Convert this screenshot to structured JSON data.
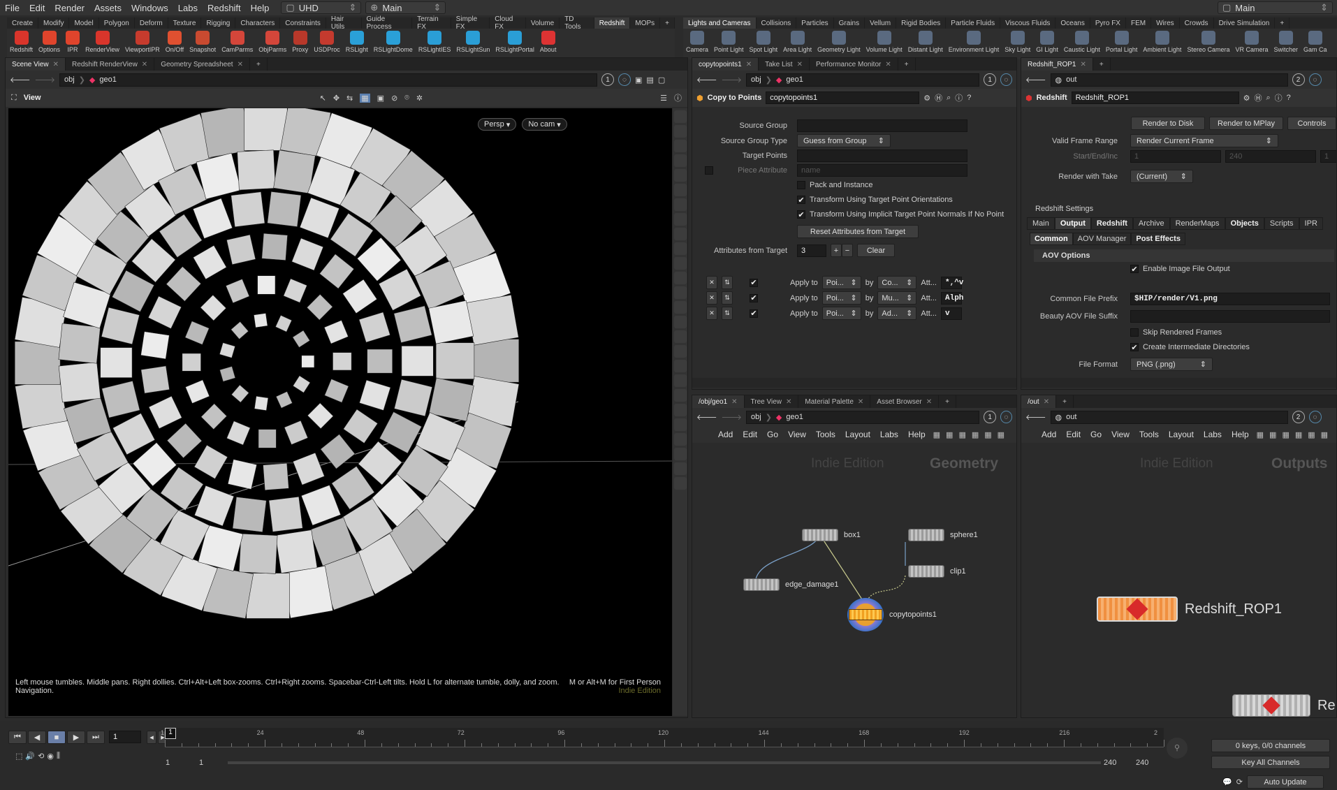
{
  "menubar": {
    "items": [
      "File",
      "Edit",
      "Render",
      "Assets",
      "Windows",
      "Labs",
      "Redshift",
      "Help"
    ],
    "desktop": "UHD",
    "context": "Main",
    "right_desktop": "Main"
  },
  "shelf_left": {
    "tabs": [
      "Create",
      "Modify",
      "Model",
      "Polygon",
      "Deform",
      "Texture",
      "Rigging",
      "Characters",
      "Constraints",
      "Hair Utils",
      "Guide Process",
      "Terrain FX",
      "Simple FX",
      "Cloud FX",
      "Volume",
      "TD Tools",
      "Redshift",
      "MOPs"
    ],
    "active_tab": "Redshift",
    "tools": [
      "Redshift",
      "Options",
      "IPR",
      "RenderView",
      "ViewportIPR",
      "On/Off",
      "Snapshot",
      "CamParms",
      "ObjParms",
      "Proxy",
      "USDProc",
      "RSLight",
      "RSLightDome",
      "RSLightIES",
      "RSLightSun",
      "RSLightPortal",
      "About"
    ],
    "tool_colors": [
      "#d9352b",
      "#e0442c",
      "#e0442c",
      "#d9352b",
      "#c73b2d",
      "#e05030",
      "#c94a30",
      "#d4463a",
      "#d4463a",
      "#b8382a",
      "#c43a2e",
      "#2aa0d8",
      "#2aa0d8",
      "#2a9ed6",
      "#2a9ed6",
      "#2a9ed6",
      "#d33"
    ]
  },
  "shelf_right": {
    "tabs": [
      "Lights and Cameras",
      "Collisions",
      "Particles",
      "Grains",
      "Vellum",
      "Rigid Bodies",
      "Particle Fluids",
      "Viscous Fluids",
      "Oceans",
      "Pyro FX",
      "FEM",
      "Wires",
      "Crowds",
      "Drive Simulation"
    ],
    "active_tab": "Lights and Cameras",
    "tools": [
      "Camera",
      "Point Light",
      "Spot Light",
      "Area Light",
      "Geometry Light",
      "Volume Light",
      "Distant Light",
      "Environment Light",
      "Sky Light",
      "GI Light",
      "Caustic Light",
      "Portal Light",
      "Ambient Light",
      "Stereo Camera",
      "VR Camera",
      "Switcher",
      "Gam Ca"
    ]
  },
  "scene_panel": {
    "tabs": [
      "Scene View",
      "Redshift RenderView",
      "Geometry Spreadsheet"
    ],
    "path_root": "obj",
    "path_node": "geo1",
    "counter": "1",
    "view_label": "View",
    "persp": "Persp",
    "cam": "No cam",
    "help_text": "Left mouse tumbles. Middle pans. Right dollies. Ctrl+Alt+Left box-zooms. Ctrl+Right zooms. Spacebar-Ctrl-Left tilts. Hold L for alternate tumble, dolly, and zoom.",
    "help_text2": "Navigation.",
    "help_right": "M or Alt+M for First Person",
    "edition": "Indie Edition"
  },
  "param_panel": {
    "tabs": [
      "copytopoints1",
      "Take List",
      "Performance Monitor"
    ],
    "path_root": "obj",
    "path_node": "geo1",
    "counter": "1",
    "node_type": "Copy to Points",
    "node_name": "copytopoints1",
    "source_group_label": "Source Group",
    "source_group_type_label": "Source Group Type",
    "source_group_type": "Guess from Group",
    "target_points_label": "Target Points",
    "piece_attribute_label": "Piece Attribute",
    "piece_attribute_placeholder": "name",
    "pack_label": "Pack and Instance",
    "orient_label": "Transform Using Target Point Orientations",
    "normals_label": "Transform Using Implicit Target Point Normals If No Point",
    "reset_btn": "Reset Attributes from Target",
    "attrs_label": "Attributes from Target",
    "attrs_count": "3",
    "clear_btn": "Clear",
    "attr_rows": [
      {
        "apply": "Apply to",
        "target": "Poi...",
        "by": "by",
        "method": "Co...",
        "att": "Att...",
        "value": "*,^v"
      },
      {
        "apply": "Apply to",
        "target": "Poi...",
        "by": "by",
        "method": "Mu...",
        "att": "Att...",
        "value": "Alph"
      },
      {
        "apply": "Apply to",
        "target": "Poi...",
        "by": "by",
        "method": "Ad...",
        "att": "Att...",
        "value": "v"
      }
    ]
  },
  "rop_panel": {
    "tabs": [
      "Redshift_ROP1"
    ],
    "path": "out",
    "counter": "2",
    "node_type": "Redshift",
    "node_name": "Redshift_ROP1",
    "render_disk": "Render to Disk",
    "render_mplay": "Render to MPlay",
    "controls": "Controls",
    "valid_range_label": "Valid Frame Range",
    "valid_range": "Render Current Frame",
    "startend_label": "Start/End/Inc",
    "start": "1",
    "end": "240",
    "inc": "1",
    "take_label": "Render with Take",
    "take": "(Current)",
    "settings_label": "Redshift Settings",
    "tabs2": [
      "Main",
      "Output",
      "Redshift",
      "Archive",
      "RenderMaps",
      "Objects",
      "Scripts",
      "IPR"
    ],
    "active_tab2": "Output",
    "subtabs": [
      "Common",
      "AOV Manager",
      "Post Effects"
    ],
    "aov_header": "AOV Options",
    "enable_output": "Enable Image File Output",
    "prefix_label": "Common File Prefix",
    "prefix": "$HIP/render/V1.png",
    "suffix_label": "Beauty AOV File Suffix",
    "skip_label": "Skip Rendered Frames",
    "create_dirs": "Create Intermediate Directories",
    "format_label": "File Format",
    "format": "PNG (.png)"
  },
  "network_geo": {
    "tabs": [
      "/obj/geo1",
      "Tree View",
      "Material Palette",
      "Asset Browser"
    ],
    "path_root": "obj",
    "path_node": "geo1",
    "counter": "1",
    "menu": [
      "Add",
      "Edit",
      "Go",
      "View",
      "Tools",
      "Layout",
      "Labs",
      "Help"
    ],
    "watermark": "Indie Edition",
    "context": "Geometry",
    "nodes": [
      {
        "name": "box1"
      },
      {
        "name": "sphere1"
      },
      {
        "name": "clip1"
      },
      {
        "name": "edge_damage1"
      },
      {
        "name": "copytopoints1"
      }
    ]
  },
  "network_out": {
    "tabs": [
      "/out"
    ],
    "path": "out",
    "counter": "2",
    "menu": [
      "Add",
      "Edit",
      "Go",
      "View",
      "Tools",
      "Layout",
      "Labs",
      "Help"
    ],
    "watermark": "Indie Edition",
    "context": "Outputs",
    "node_name": "Redshift_ROP1",
    "node2": "Re"
  },
  "timeline": {
    "frame": "1",
    "ticks": [
      "1",
      "24",
      "48",
      "72",
      "96",
      "120",
      "144",
      "168",
      "192",
      "216",
      "2"
    ],
    "range_start": "1",
    "range_start2": "1",
    "range_end": "240",
    "range_end2": "240",
    "keys": "0 keys, 0/0 channels",
    "key_all": "Key All Channels",
    "auto_update": "Auto Update"
  }
}
